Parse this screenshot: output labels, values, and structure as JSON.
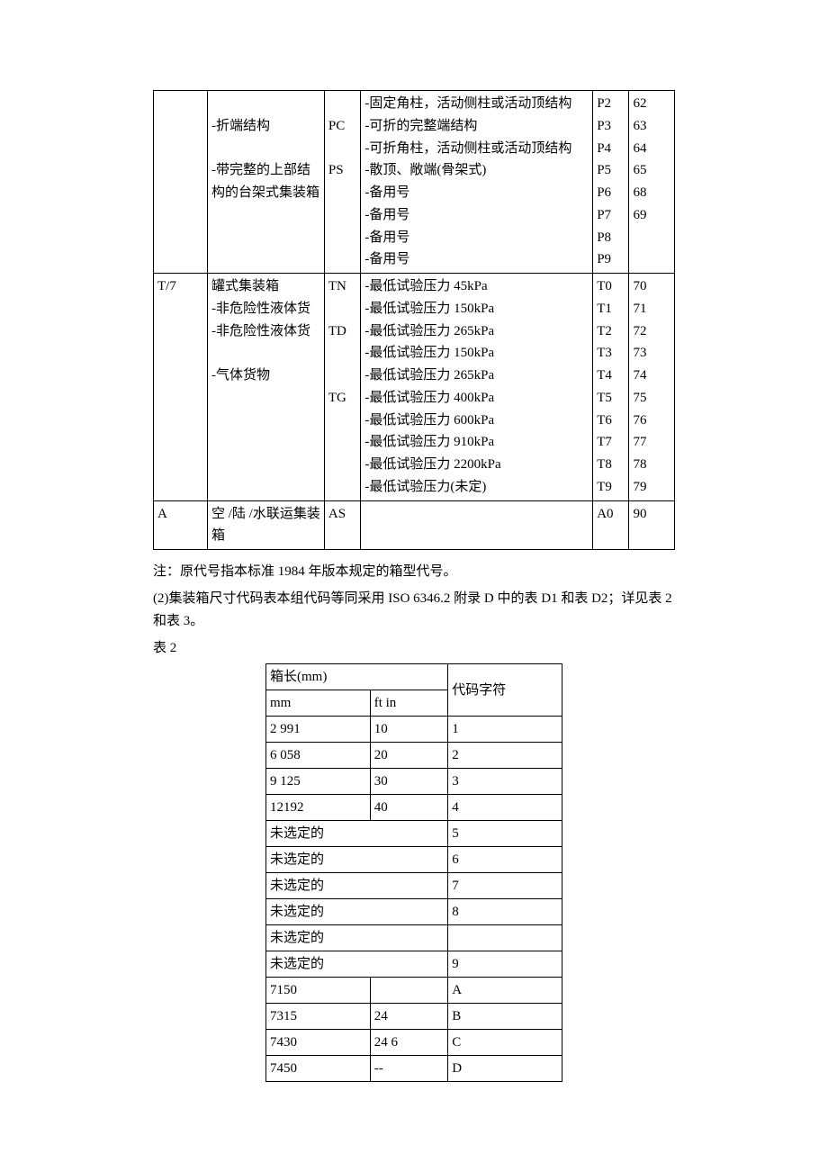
{
  "table1": {
    "rows": [
      {
        "c0": "",
        "c1": "\n-折端结构\n\n-带完整的上部结构的台架式集装箱",
        "c2": "\nPC\n\nPS",
        "c3": "-固定角柱，活动侧柱或活动顶结构\n-可折的完整端结构\n-可折角柱，活动侧柱或活动顶结构\n-散顶、敞端(骨架式)\n-备用号\n-备用号\n-备用号\n-备用号",
        "c4": "P2\nP3\nP4\nP5\nP6\nP7\nP8\nP9",
        "c5": "62\n63\n64\n65\n68\n69"
      },
      {
        "c0": "T/7",
        "c1": "罐式集装箱\n-非危险性液体货\n-非危险性液体货\n\n-气体货物",
        "c2": "TN\n\nTD\n\n\nTG",
        "c3": "-最低试验压力 45kPa\n-最低试验压力 150kPa\n-最低试验压力 265kPa\n-最低试验压力 150kPa\n-最低试验压力 265kPa\n-最低试验压力 400kPa\n-最低试验压力 600kPa\n-最低试验压力 910kPa\n-最低试验压力 2200kPa\n-最低试验压力(未定)",
        "c4": "T0\nT1\nT2\nT3\nT4\nT5\nT6\nT7\nT8\nT9",
        "c5": "70\n71\n72\n73\n74\n75\n76\n77\n78\n79"
      },
      {
        "c0": "A",
        "c1": "空 /陆 /水联运集装箱",
        "c2": "AS",
        "c3": "",
        "c4": "A0",
        "c5": "90"
      }
    ]
  },
  "note1": "注：原代号指本标准 1984 年版本规定的箱型代号。",
  "note2": "(2)集装箱尺寸代码表本组代码等同采用 ISO 6346.2 附录 D 中的表 D1 和表 D2；详见表 2 和表 3。",
  "note3": "表 2",
  "table2": {
    "h_len": "箱长(mm)",
    "h_mm": "mm",
    "h_ftin": "ft in",
    "h_code": "代码字符",
    "rows": [
      {
        "mm": "2 991",
        "ftin": "10",
        "code": "1",
        "span": false
      },
      {
        "mm": "6 058",
        "ftin": "20",
        "code": "2",
        "span": false
      },
      {
        "mm": "9 125",
        "ftin": "30",
        "code": "3",
        "span": false
      },
      {
        "mm": "12192",
        "ftin": "40",
        "code": "4",
        "span": false
      },
      {
        "mm": "未选定的",
        "ftin": "",
        "code": "5",
        "span": true
      },
      {
        "mm": "未选定的",
        "ftin": "",
        "code": "6",
        "span": true
      },
      {
        "mm": "未选定的",
        "ftin": "",
        "code": "7",
        "span": true
      },
      {
        "mm": "未选定的",
        "ftin": "",
        "code": "8",
        "span": true
      },
      {
        "mm": "未选定的",
        "ftin": "",
        "code": "",
        "span": true
      },
      {
        "mm": "未选定的",
        "ftin": "",
        "code": "9",
        "span": true
      },
      {
        "mm": "7150",
        "ftin": "",
        "code": "A",
        "span": false
      },
      {
        "mm": "7315",
        "ftin": "24",
        "code": "B",
        "span": false
      },
      {
        "mm": "7430",
        "ftin": "24 6",
        "code": "C",
        "span": false
      },
      {
        "mm": "7450",
        "ftin": "--",
        "code": "D",
        "span": false
      }
    ]
  }
}
